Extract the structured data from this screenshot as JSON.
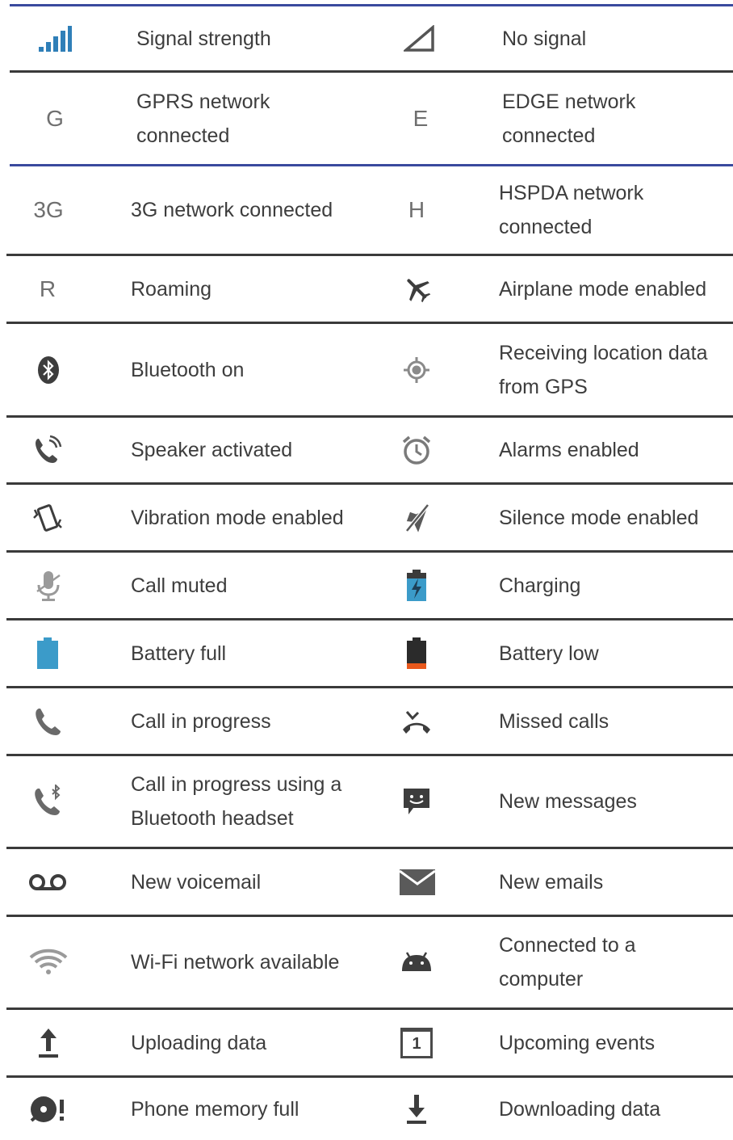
{
  "colors": {
    "rule_blue": "#3a4a9e",
    "rule_dark": "#3a3a3a",
    "icon_gray": "#6f6f6f",
    "icon_blue": "#3b9bc9",
    "battery_low": "#e8581c",
    "signal_blue": "#2f7fb8"
  },
  "rows": [
    {
      "left": {
        "icon": "signal-strength-icon",
        "label": "Signal strength"
      },
      "right": {
        "icon": "no-signal-icon",
        "label": "No signal"
      }
    },
    {
      "left": {
        "icon": "gprs-icon",
        "glyph": "G",
        "label": "GPRS network\nconnected"
      },
      "right": {
        "icon": "edge-icon",
        "glyph": "E",
        "label": "EDGE network\nconnected"
      }
    },
    {
      "left": {
        "icon": "3g-icon",
        "glyph": "3G",
        "label": "3G network connected"
      },
      "right": {
        "icon": "hspda-icon",
        "glyph": "H",
        "label": "HSPDA network\nconnected"
      }
    },
    {
      "left": {
        "icon": "roaming-icon",
        "glyph": "R",
        "label": "Roaming"
      },
      "right": {
        "icon": "airplane-icon",
        "label": "Airplane mode enabled"
      }
    },
    {
      "left": {
        "icon": "bluetooth-icon",
        "label": "Bluetooth on"
      },
      "right": {
        "icon": "gps-icon",
        "label": "Receiving location data\nfrom GPS"
      }
    },
    {
      "left": {
        "icon": "speaker-phone-icon",
        "label": "Speaker activated"
      },
      "right": {
        "icon": "alarm-icon",
        "label": "Alarms enabled"
      }
    },
    {
      "left": {
        "icon": "vibration-icon",
        "label": "Vibration mode enabled"
      },
      "right": {
        "icon": "silence-icon",
        "label": "Silence mode enabled"
      }
    },
    {
      "left": {
        "icon": "mic-muted-icon",
        "label": "Call muted"
      },
      "right": {
        "icon": "charging-icon",
        "label": "Charging"
      }
    },
    {
      "left": {
        "icon": "battery-full-icon",
        "label": "Battery full"
      },
      "right": {
        "icon": "battery-low-icon",
        "label": "Battery low"
      }
    },
    {
      "left": {
        "icon": "call-icon",
        "label": "Call in progress"
      },
      "right": {
        "icon": "missed-call-icon",
        "label": "Missed calls"
      }
    },
    {
      "left": {
        "icon": "bluetooth-call-icon",
        "label": "Call in progress using a\nBluetooth headset"
      },
      "right": {
        "icon": "message-icon",
        "label": "New messages"
      }
    },
    {
      "left": {
        "icon": "voicemail-icon",
        "label": "New voicemail"
      },
      "right": {
        "icon": "email-icon",
        "label": "New emails"
      }
    },
    {
      "left": {
        "icon": "wifi-icon",
        "label": "Wi-Fi network available"
      },
      "right": {
        "icon": "usb-android-icon",
        "label": "Connected to a\ncomputer"
      }
    },
    {
      "left": {
        "icon": "upload-icon",
        "label": "Uploading data"
      },
      "right": {
        "icon": "calendar-icon",
        "glyph": "1",
        "label": "Upcoming events"
      }
    },
    {
      "left": {
        "icon": "memory-full-icon",
        "label": "Phone memory full"
      },
      "right": {
        "icon": "download-icon",
        "label": "Downloading data"
      }
    }
  ]
}
